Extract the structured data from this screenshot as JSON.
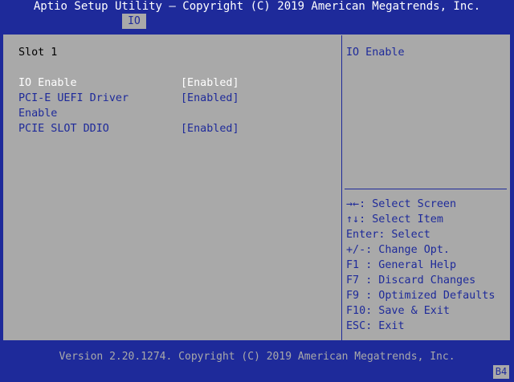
{
  "header": {
    "title": "Aptio Setup Utility – Copyright (C) 2019 American Megatrends, Inc.",
    "tabs": [
      {
        "label": "IO"
      }
    ]
  },
  "main": {
    "section_title": "Slot 1",
    "items": [
      {
        "label": "IO Enable",
        "value": "[Enabled]"
      },
      {
        "label_line1": "PCI-E UEFI Driver",
        "label_line2": "Enable",
        "value": "[Enabled]"
      },
      {
        "label": "PCIE SLOT DDIO",
        "value": "[Enabled]"
      }
    ]
  },
  "help": {
    "title": "IO Enable",
    "keys": [
      {
        "key": "→←",
        "desc": ": Select Screen"
      },
      {
        "key": "↑↓",
        "desc": ": Select Item"
      },
      {
        "key": "Enter",
        "desc": ": Select"
      },
      {
        "key": "+/-",
        "desc": ": Change Opt."
      },
      {
        "key": "F1 ",
        "desc": ": General Help"
      },
      {
        "key": "F7 ",
        "desc": ": Discard Changes"
      },
      {
        "key": "F9 ",
        "desc": ": Optimized Defaults"
      },
      {
        "key": "F10",
        "desc": ": Save & Exit"
      },
      {
        "key": "ESC",
        "desc": ": Exit"
      }
    ]
  },
  "footer": {
    "version": "Version 2.20.1274. Copyright (C) 2019 American Megatrends, Inc.",
    "badge": "B4"
  },
  "colors": {
    "bar_blue": "#1e2a9a",
    "panel_gray": "#a9a9a9",
    "selected_text": "#ffffff"
  }
}
